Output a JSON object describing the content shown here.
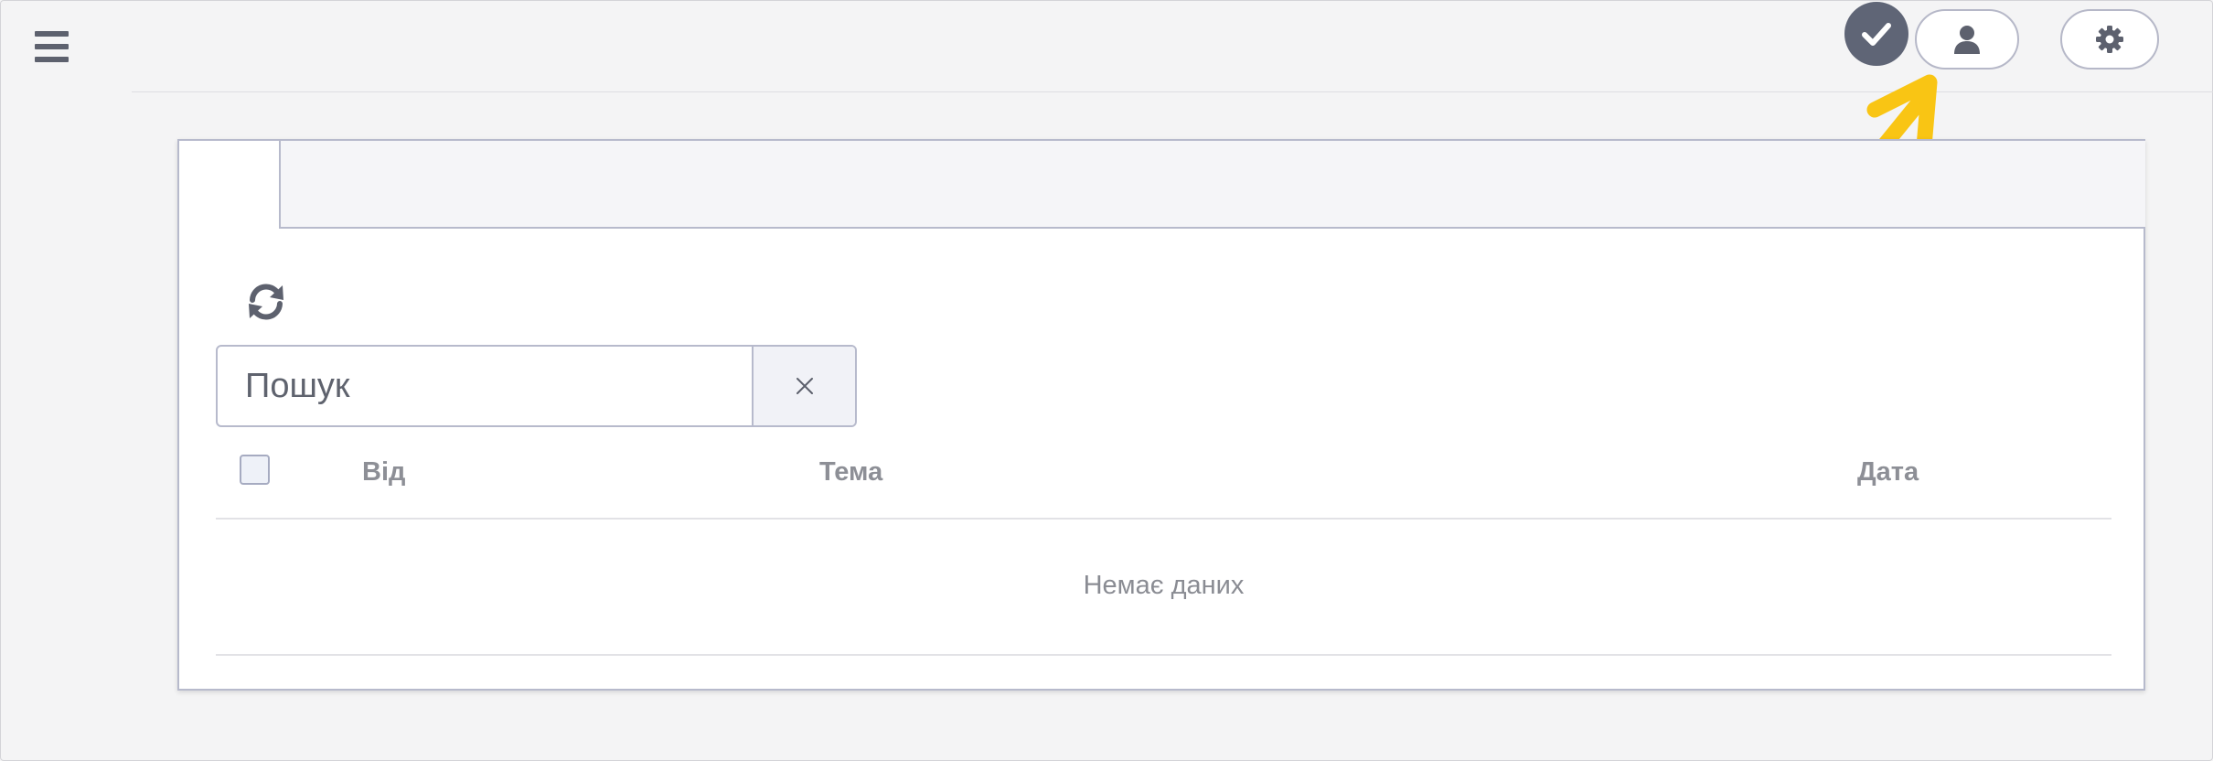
{
  "header": {
    "menu_icon": "hamburger-menu-icon",
    "status_icon": "check-icon",
    "user_icon": "user-icon",
    "settings_icon": "gear-icon"
  },
  "annotation": {
    "arrow_color": "#f9c514"
  },
  "toolbar": {
    "refresh_icon": "refresh-icon"
  },
  "search": {
    "placeholder": "Пошук",
    "value": "",
    "clear_icon": "close-icon"
  },
  "table": {
    "columns": [
      "Від",
      "Тема",
      "Дата"
    ],
    "empty_text": "Немає даних"
  },
  "colors": {
    "accent": "#5f6576",
    "border": "#b7bacc",
    "background": "#f4f4f5"
  }
}
